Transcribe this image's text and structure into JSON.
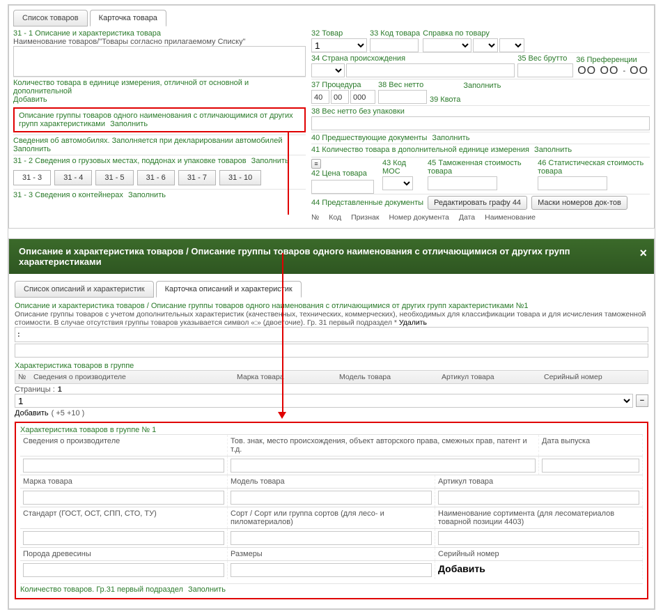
{
  "tabs_top": {
    "list": "Список товаров",
    "card": "Карточка товара"
  },
  "s31": {
    "title": "31 - 1 Описание и характеристика товара",
    "naim": "Наименование товаров/\"Товары согласно прилагаемому Списку\"",
    "qty": "Количество товара в единице измерения, отличной от основной и дополнительной",
    "add": "Добавить",
    "groupdesc": "Описание группы товаров одного наименования с отличающимися от других групп характеристиками",
    "fill": "Заполнить",
    "auto": "Сведения об автомобилях. Заполняется при декларировании автомобилей",
    "s31_2": "31 - 2 Сведения о грузовых местах, поддонах и упаковке товаров",
    "numtabs": [
      "31 - 3",
      "31 - 4",
      "31 - 5",
      "31 - 6",
      "31 - 7",
      "31 - 10"
    ],
    "s31_3": "31 - 3 Сведения о контейнерах"
  },
  "right": {
    "c32": "32 Товар",
    "v32": "1",
    "c33": "33 Код товара",
    "sprav": "Справка по товару",
    "c34": "34 Страна происхождения",
    "c35": "35 Вес брутто",
    "c36": "36 Преференции",
    "pref": "ОО ОО",
    "dash": "-",
    "pref2": "ОО",
    "c37": "37 Процедура",
    "v37a": "40",
    "v37b": "00",
    "v37c": "000",
    "c38": "38 Вес нетто",
    "c39": "39 Квота",
    "c38f": "38 Вес нетто без упаковки",
    "c40": "40 Предшествующие документы",
    "c41": "41 Количество товара в дополнительной единице измерения",
    "c42": "42 Цена товара",
    "c43": "43 Код МОС",
    "c45": "45 Таможенная стоимость товара",
    "c46": "46 Статистическая стоимость товара",
    "c44": "44 Представленные документы",
    "btn44": "Редактировать графу 44",
    "btnMask": "Маски номеров док-тов",
    "leg": {
      "no": "№",
      "kod": "Код",
      "priz": "Признак",
      "nd": "Номер документа",
      "date": "Дата",
      "naim": "Наименование"
    }
  },
  "fill": "Заполнить",
  "panel2": {
    "title": "Описание и характеристика товаров / Описание группы товаров одного наименования с отличающимися от других групп характеристиками",
    "tabs": {
      "list": "Список описаний и характеристик",
      "card": "Карточка описаний и характеристик"
    },
    "bc": "Описание и характеристика товаров / Описание группы товаров одного наименования с отличающимися от других групп характеристиками №1",
    "note": "Описание группы товаров с учетом дополнительных характеристик (качественных, технических, коммерческих), необходимых для классификации товара и для исчисления таможенной стоимости. В случае отсутствия группы товаров указывается символ «:» (двоеточие). Гр. 31 первый подраздел *",
    "del": "Удалить",
    "colon": ":",
    "char": "Характеристика товаров в группе",
    "th": {
      "no": "№",
      "prod": "Сведения о производителе",
      "mark": "Марка товара",
      "model": "Модель товара",
      "art": "Артикул товара",
      "ser": "Серийный номер"
    },
    "pages": "Страницы :",
    "pg": "1",
    "opt1": "1",
    "addline": "Добавить",
    "addline2": "( +5   +10 )",
    "char1": "Характеристика товаров в группе № 1",
    "r1": {
      "prod": "Сведения о производителе",
      "tov": "Тов. знак, место происхождения, объект авторского права, смежных прав, патент и т.д.",
      "date": "Дата выпуска"
    },
    "r2": {
      "mark": "Марка товара",
      "model": "Модель товара",
      "art": "Артикул товара"
    },
    "r3": {
      "std": "Стандарт (ГОСТ, ОСТ, СПП, СТО, ТУ)",
      "sort": "Сорт / Сорт или группа сортов (для лесо- и пиломатериалов)",
      "naim": "Наименование сортимента (для лесоматериалов товарной позиции 4403)"
    },
    "r4": {
      "wood": "Порода древесины",
      "size": "Размеры",
      "ser": "Серийный номер"
    },
    "addbig": "Добавить",
    "qty": "Количество товаров. Гр.31 первый подраздел"
  }
}
